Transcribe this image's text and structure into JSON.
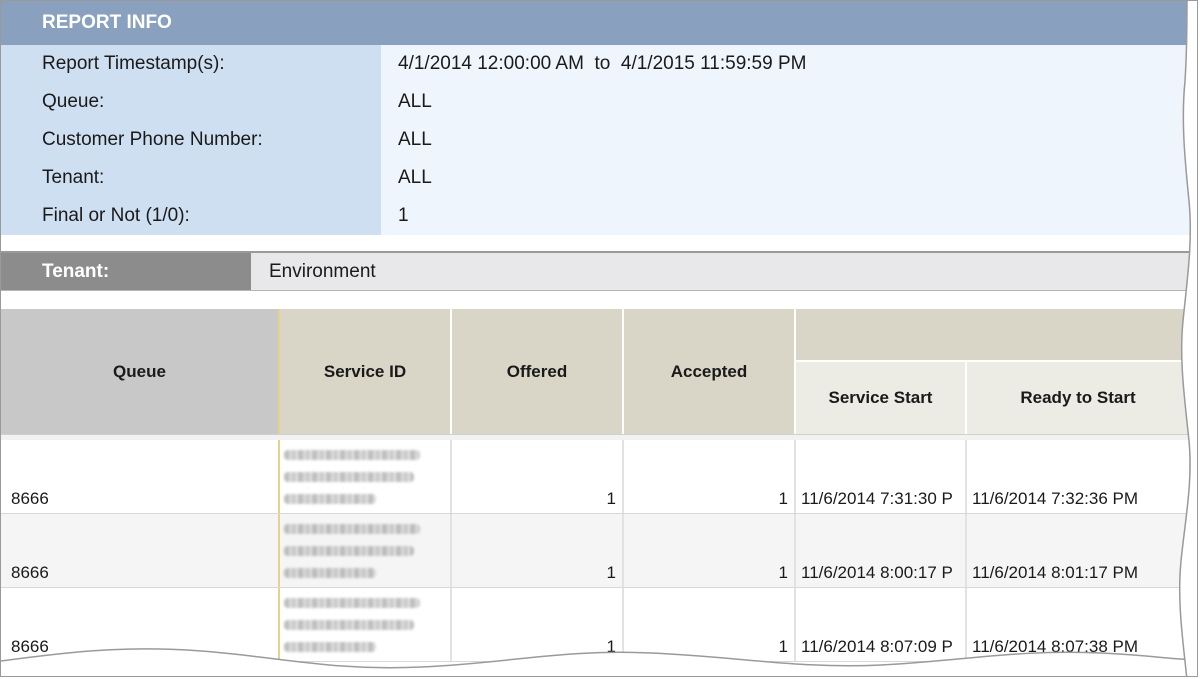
{
  "report_info": {
    "title": "REPORT INFO",
    "rows": [
      {
        "label": "Report Timestamp(s):",
        "value": "4/1/2014 12:00:00 AM  to  4/1/2015 11:59:59 PM"
      },
      {
        "label": "Queue:",
        "value": "ALL"
      },
      {
        "label": "Customer Phone Number:",
        "value": "ALL"
      },
      {
        "label": "Tenant:",
        "value": "ALL"
      },
      {
        "label": "Final or Not (1/0):",
        "value": "1"
      }
    ]
  },
  "tenant": {
    "label": "Tenant:",
    "value": "Environment"
  },
  "table": {
    "headers": {
      "queue": "Queue",
      "service_id": "Service ID",
      "offered": "Offered",
      "accepted": "Accepted",
      "service_start": "Service Start",
      "ready_to_start": "Ready to Start"
    },
    "rows": [
      {
        "queue": "8666",
        "offered": "1",
        "accepted": "1",
        "service_start": "11/6/2014 7:31:30 P",
        "ready_to_start": "11/6/2014 7:32:36 PM"
      },
      {
        "queue": "8666",
        "offered": "1",
        "accepted": "1",
        "service_start": "11/6/2014 8:00:17 P",
        "ready_to_start": "11/6/2014 8:01:17 PM"
      },
      {
        "queue": "8666",
        "offered": "1",
        "accepted": "1",
        "service_start": "11/6/2014 8:07:09 P",
        "ready_to_start": "11/6/2014 8:07:38 PM"
      }
    ]
  },
  "colors": {
    "report_header": "#8aa0bf",
    "label_bg": "#cfdff2",
    "value_bg": "#eef5fd",
    "tenant_label_bg": "#8c8c8c",
    "header_gray": "#c8c8c8",
    "header_tan": "#d9d5c7"
  }
}
